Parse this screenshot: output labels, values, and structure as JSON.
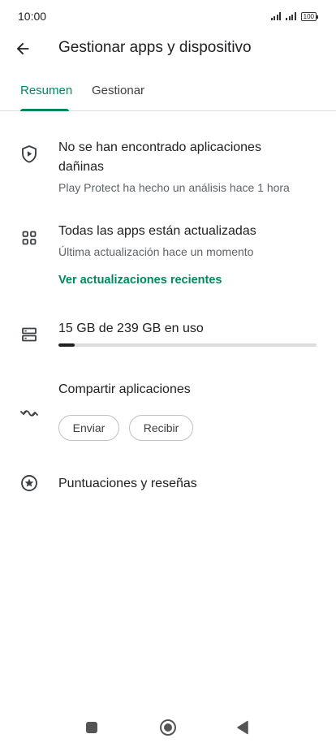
{
  "status_bar": {
    "time": "10:00",
    "battery": "100"
  },
  "header": {
    "title": "Gestionar apps y dispositivo"
  },
  "tabs": [
    {
      "label": "Resumen",
      "active": true
    },
    {
      "label": "Gestionar",
      "active": false
    }
  ],
  "protect": {
    "icon": "play-protect-shield-icon",
    "title": "No se han encontrado aplicaciones dañinas",
    "subtitle": "Play Protect ha hecho un análisis hace 1 hora"
  },
  "updates": {
    "icon": "apps-grid-icon",
    "title": "Todas las apps están actualizadas",
    "subtitle": "Última actualización hace un momento",
    "link": "Ver actualizaciones recientes"
  },
  "storage": {
    "icon": "storage-icon",
    "label": "15 GB de 239 GB en uso",
    "used_fraction": 0.063
  },
  "share": {
    "icon": "share-nearby-icon",
    "title": "Compartir aplicaciones",
    "send_label": "Enviar",
    "receive_label": "Recibir"
  },
  "ratings": {
    "icon": "star-circle-icon",
    "title": "Puntuaciones y reseñas"
  },
  "colors": {
    "accent": "#01875f",
    "text_primary": "#202124",
    "text_secondary": "#5f6368",
    "divider": "#dadce0"
  }
}
